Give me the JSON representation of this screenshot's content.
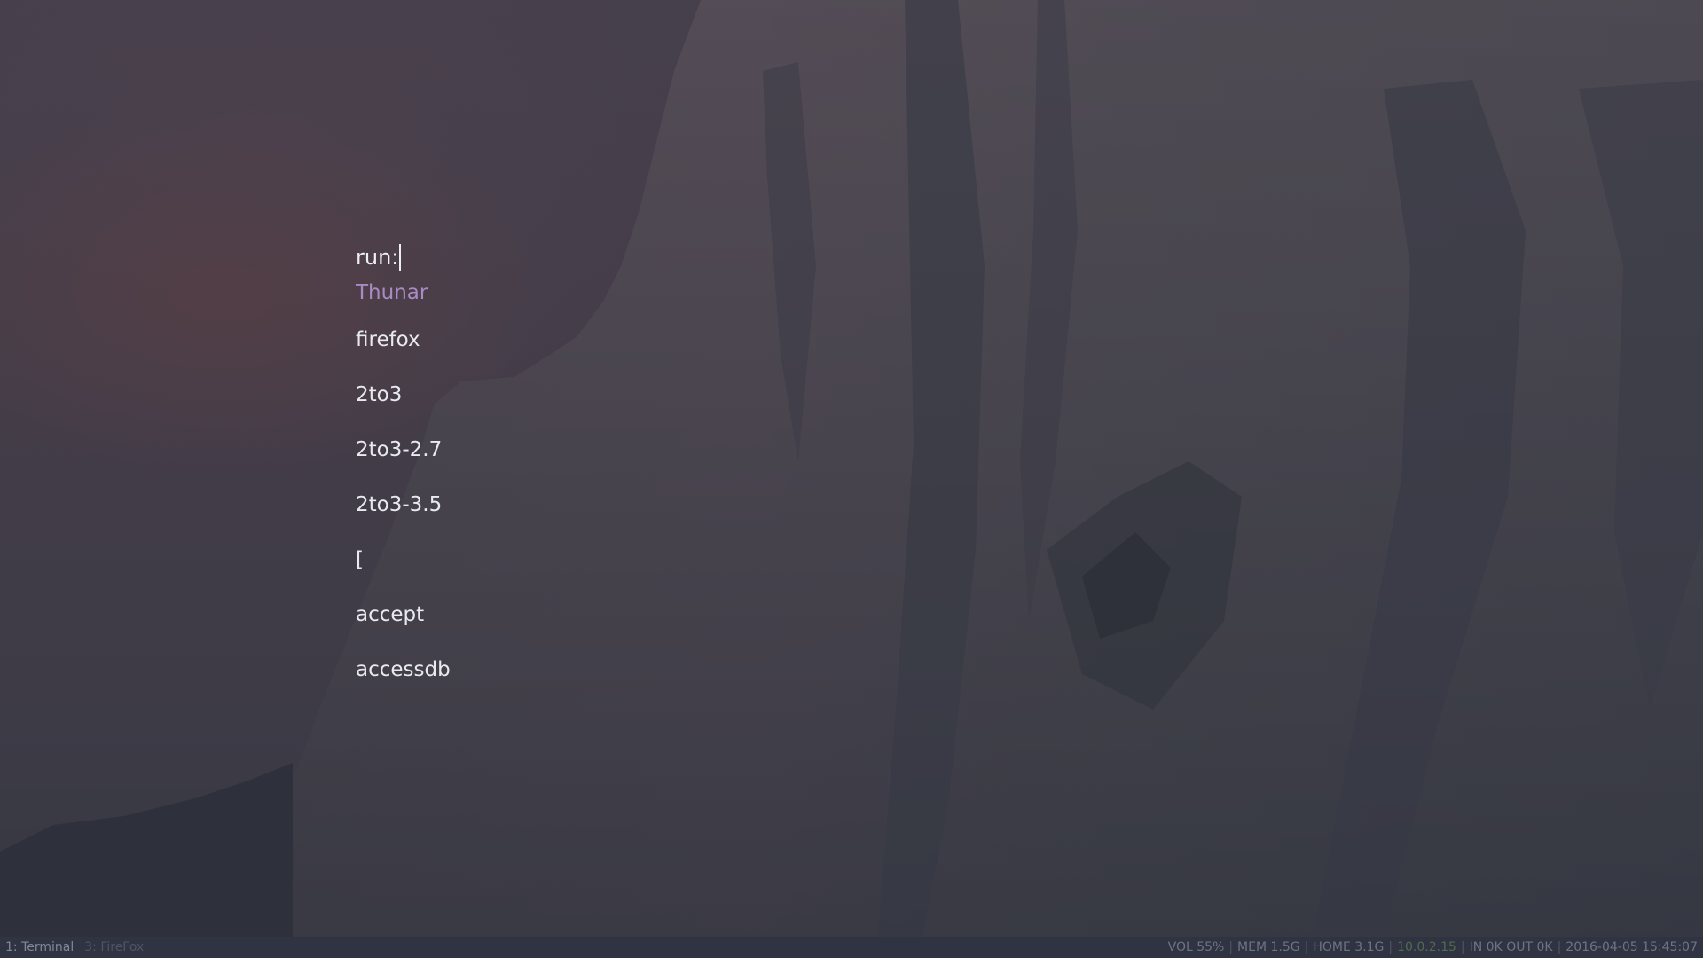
{
  "launcher": {
    "prompt_label": "run:",
    "query": "",
    "results": [
      {
        "label": "Thunar",
        "selected": true
      },
      {
        "label": "firefox",
        "selected": false
      },
      {
        "label": "2to3",
        "selected": false
      },
      {
        "label": "2to3-2.7",
        "selected": false
      },
      {
        "label": "2to3-3.5",
        "selected": false
      },
      {
        "label": "[",
        "selected": false
      },
      {
        "label": "accept",
        "selected": false
      },
      {
        "label": "accessdb",
        "selected": false
      }
    ]
  },
  "bar": {
    "workspaces": [
      {
        "label": "1: Terminal",
        "active": true
      },
      {
        "label": "3: FireFox",
        "active": false
      }
    ],
    "status": {
      "volume": "VOL 55%",
      "memory": "MEM 1.5G",
      "home": "HOME 3.1G",
      "ip": "10.0.2.15",
      "network": "IN 0K OUT 0K",
      "datetime": "2016-04-05 15:45:07"
    }
  },
  "colors": {
    "selected_result": "#a88bc4",
    "result_text": "#e8eaf0",
    "bar_background": "#303341",
    "bar_text": "#6e7386",
    "ip_text": "#4f6b50"
  }
}
